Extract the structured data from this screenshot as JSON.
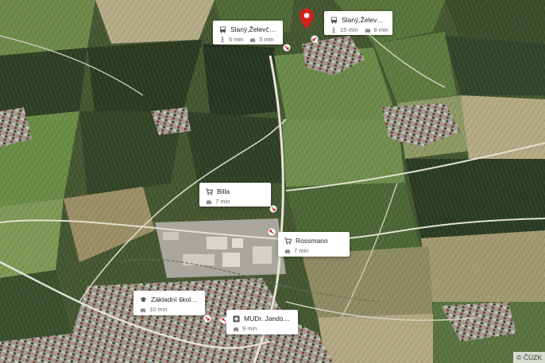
{
  "map": {
    "type": "satellite aerial map",
    "copyright": "© ČÚZK"
  },
  "pois": [
    {
      "key": "bus1",
      "name": "Slaný,Želevčice",
      "icon": "bus-icon",
      "times": [
        {
          "mode": "walk-icon",
          "text": "6 min"
        },
        {
          "mode": "car-icon",
          "text": "5 min"
        }
      ]
    },
    {
      "key": "bus2",
      "name": "Slaný,Želevčice,O...",
      "icon": "bus-icon",
      "times": [
        {
          "mode": "walk-icon",
          "text": "15 min"
        },
        {
          "mode": "car-icon",
          "text": "6 min"
        }
      ]
    },
    {
      "key": "billa",
      "name": "Billa",
      "icon": "cart-icon",
      "times": [
        {
          "mode": "car-icon",
          "text": "7 min"
        }
      ]
    },
    {
      "key": "rossmann",
      "name": "Rossmann",
      "icon": "cart-icon",
      "times": [
        {
          "mode": "car-icon",
          "text": "7 min"
        }
      ]
    },
    {
      "key": "school",
      "name": "Základní škola Sl...",
      "icon": "school-icon",
      "times": [
        {
          "mode": "car-icon",
          "text": "10 min"
        }
      ]
    },
    {
      "key": "doctor",
      "name": "MUDr. Jandourko...",
      "icon": "medical-icon",
      "times": [
        {
          "mode": "car-icon",
          "text": "9 min"
        }
      ]
    }
  ],
  "colors": {
    "pin": "#d0201f",
    "road": "#e8e4d8",
    "field_dark": "#2e3d22",
    "field_green": "#5e7a3c",
    "field_light": "#a7a572",
    "urban": "#b7b4ac"
  }
}
